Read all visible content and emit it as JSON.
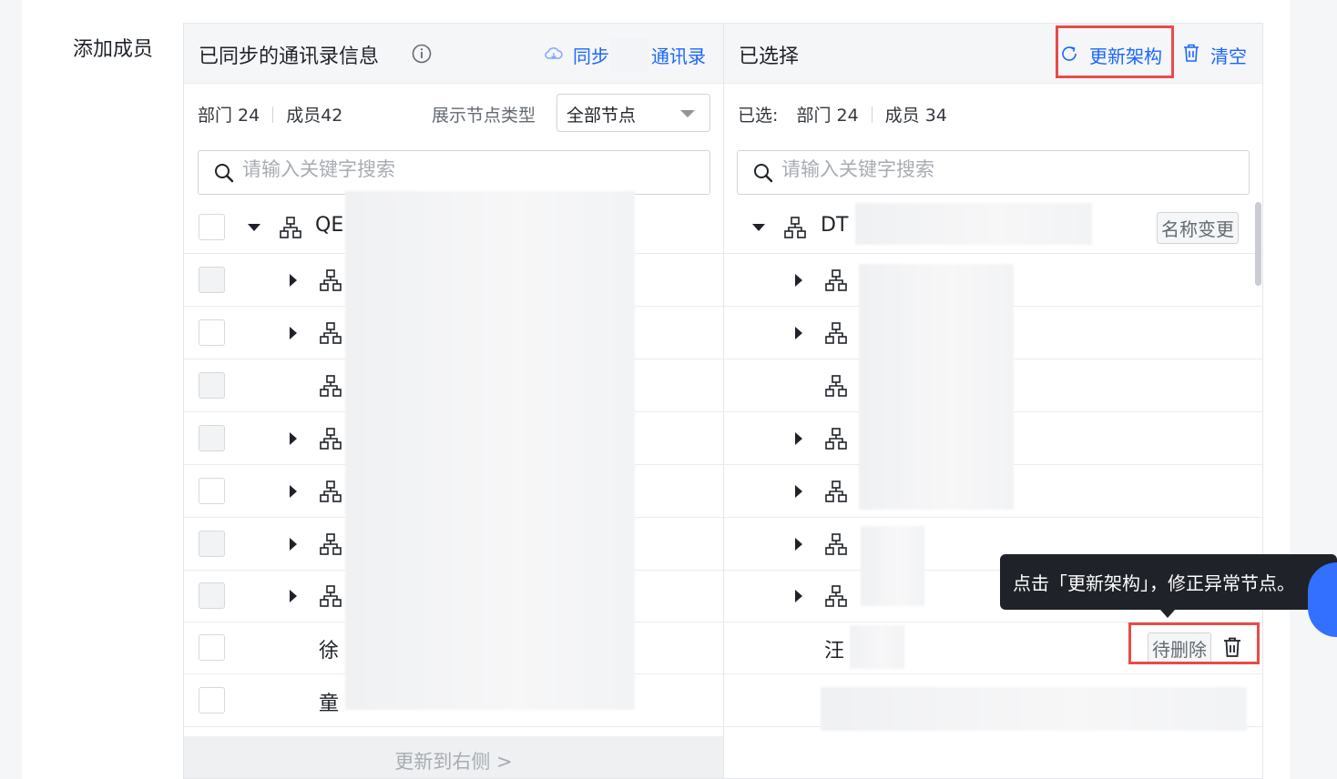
{
  "form": {
    "label": "添加成员"
  },
  "left_panel": {
    "title": "已同步的通讯录信息",
    "sync_link_1": "同步",
    "sync_link_2": "通讯录",
    "stats_dept": "部门 24",
    "stats_member": "成员42",
    "filter_label": "展示节点类型",
    "filter_value": "全部节点",
    "search_placeholder": "请输入关键字搜索",
    "root_text": "QE",
    "member_rows": [
      "徐",
      "童"
    ],
    "footer_button": "更新到右侧 >"
  },
  "right_panel": {
    "title": "已选择",
    "update_link": "更新架构",
    "clear_link": "清空",
    "selected_prefix": "已选:",
    "stats_dept": "部门 24",
    "stats_member": "成员 34",
    "search_placeholder": "请输入关键字搜索",
    "root_text": "DT",
    "name_change_tag": "名称变更",
    "member_row_text": "汪",
    "pending_delete_tag": "待删除"
  },
  "tooltip": {
    "text": "点击「更新架构」，修正异常节点。"
  },
  "colors": {
    "accent": "#1a66ff",
    "highlight": "#e74c4c",
    "tooltip_bg": "#1f2329"
  },
  "icons": [
    "info-icon",
    "cloud-sync-icon",
    "refresh-icon",
    "trash-icon",
    "search-icon",
    "org-tree-icon"
  ]
}
